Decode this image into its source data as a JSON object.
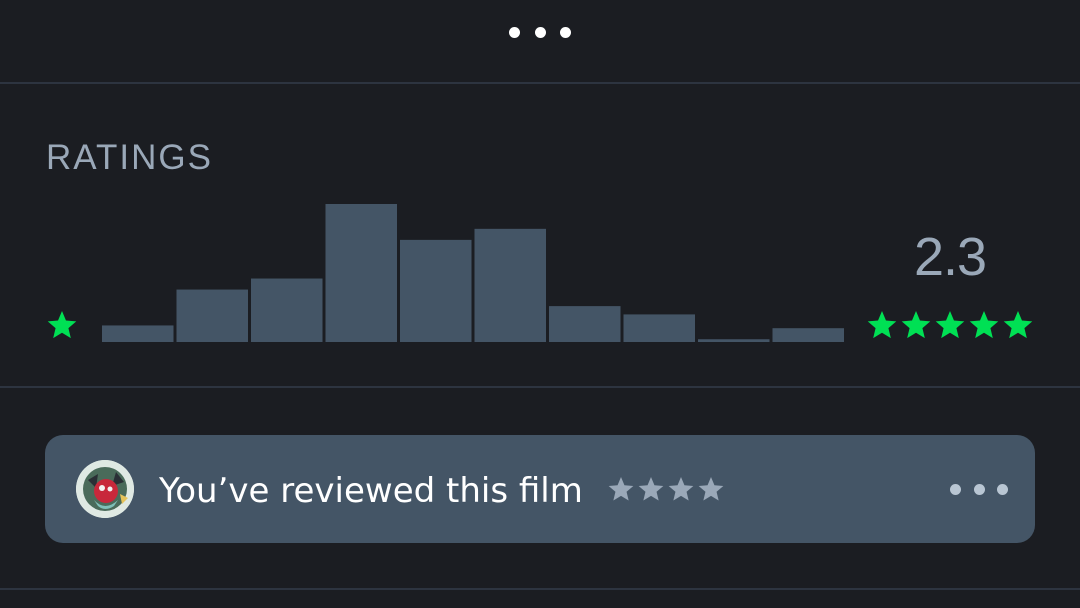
{
  "ratings": {
    "title": "RATINGS",
    "average": "2.3",
    "low_star_icon": "star-icon",
    "high_star_icons": [
      "star-icon",
      "star-icon",
      "star-icon",
      "star-icon",
      "star-icon"
    ],
    "accent_color": "#00e054",
    "bar_color": "#445566"
  },
  "chart_data": {
    "type": "bar",
    "categories": [
      "0.5",
      "1",
      "1.5",
      "2",
      "2.5",
      "3",
      "3.5",
      "4",
      "4.5",
      "5"
    ],
    "values": [
      12,
      38,
      46,
      100,
      74,
      82,
      26,
      20,
      2,
      10
    ],
    "ylim": [
      0,
      100
    ],
    "xlabel": "",
    "ylabel": "",
    "grid": false
  },
  "review": {
    "text": "You’ve reviewed this film",
    "rating_stars": 4,
    "star_color": "#9aa8b8",
    "avatar_icon": "user-avatar"
  }
}
